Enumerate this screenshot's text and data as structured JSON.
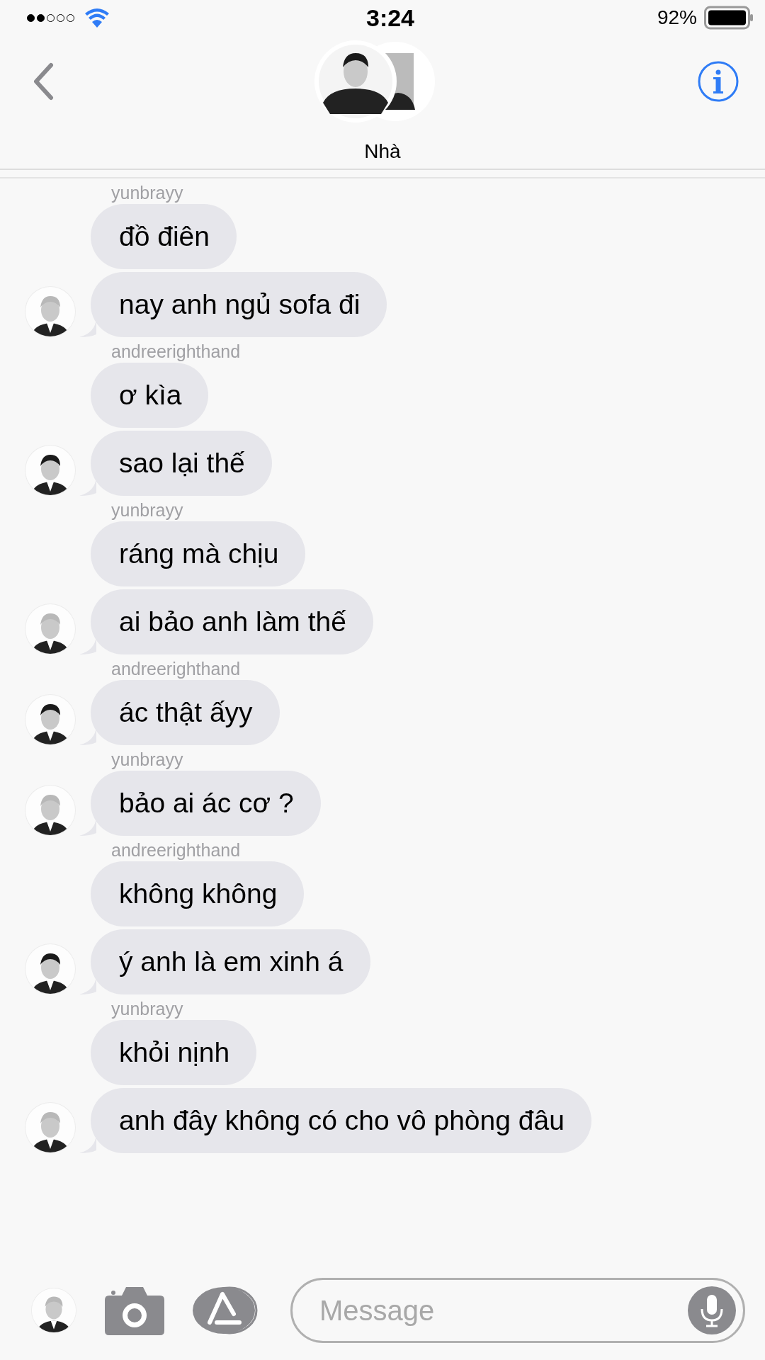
{
  "status_bar": {
    "time": "3:24",
    "battery": "92%"
  },
  "header": {
    "title": "Nhà"
  },
  "groups": [
    {
      "sender": "yunbrayy",
      "dark_hair": false,
      "messages": [
        "đồ điên",
        "nay anh ngủ sofa đi"
      ]
    },
    {
      "sender": "andreerighthand",
      "dark_hair": true,
      "messages": [
        "ơ kìa",
        "sao lại thế"
      ]
    },
    {
      "sender": "yunbrayy",
      "dark_hair": false,
      "messages": [
        "ráng mà chịu",
        "ai bảo anh làm thế"
      ]
    },
    {
      "sender": "andreerighthand",
      "dark_hair": true,
      "messages": [
        "ác thật ấyy"
      ]
    },
    {
      "sender": "yunbrayy",
      "dark_hair": false,
      "messages": [
        "bảo ai ác cơ ?"
      ]
    },
    {
      "sender": "andreerighthand",
      "dark_hair": true,
      "messages": [
        "không không",
        "ý anh là em xinh á"
      ]
    },
    {
      "sender": "yunbrayy",
      "dark_hair": false,
      "messages": [
        "khỏi nịnh",
        "anh đây không có cho vô phòng đâu"
      ]
    }
  ],
  "composer": {
    "placeholder": "Message"
  }
}
